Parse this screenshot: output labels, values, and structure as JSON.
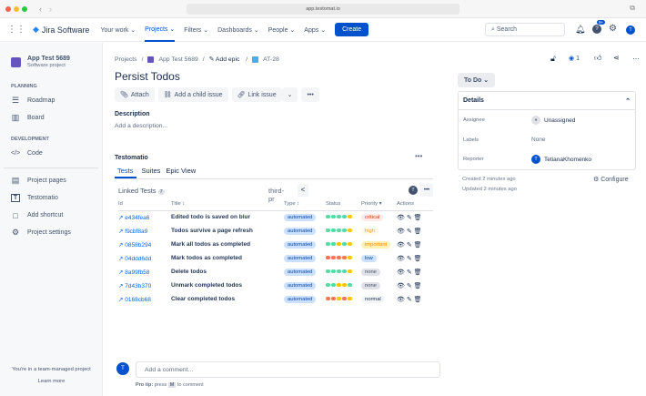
{
  "browser": {
    "url": "app.testomat.io"
  },
  "topnav": {
    "product": "Jira Software",
    "items": [
      "Your work",
      "Projects",
      "Filters",
      "Dashboards",
      "People",
      "Apps"
    ],
    "create": "Create",
    "search_placeholder": "Search",
    "notif_badge": "9+",
    "avatar": "T"
  },
  "sidebar": {
    "project_name": "App Test 5689",
    "project_type": "Software project",
    "planning": "PLANNING",
    "roadmap": "Roadmap",
    "board": "Board",
    "development": "DEVELOPMENT",
    "code": "Code",
    "project_pages": "Project pages",
    "testomatio": "Testomatio",
    "add_shortcut": "Add shortcut",
    "project_settings": "Project settings",
    "team_note": "You're in a team-managed project",
    "learn_more": "Learn more"
  },
  "breadcrumb": {
    "projects": "Projects",
    "project": "App Test 5689",
    "epic": "Add epic",
    "issue": "AT-28"
  },
  "issue": {
    "title": "Persist Todos",
    "attach": "Attach",
    "add_child": "Add a child issue",
    "link_issue": "Link issue",
    "description_label": "Description",
    "description_placeholder": "Add a description...",
    "watch_count": "1"
  },
  "testomatio": {
    "title": "Testomatio",
    "tabs": [
      "Tests",
      "Suites",
      "Epic View"
    ],
    "linked_tests": "Linked Tests",
    "count": "7",
    "branch": "third-pr",
    "avatar": "T",
    "columns": [
      "Id",
      "Title",
      "Type",
      "Status",
      "Priority",
      "Actions"
    ],
    "rows": [
      {
        "id": "e434fea6",
        "title": "Edited todo is saved on blur",
        "type": "automated",
        "status": [
          "g",
          "g",
          "g",
          "g",
          "y"
        ],
        "priority": "critical"
      },
      {
        "id": "f9cbf8a9",
        "title": "Todos survive a page refresh",
        "type": "automated",
        "status": [
          "g",
          "g",
          "g",
          "g",
          "y"
        ],
        "priority": "high"
      },
      {
        "id": "0858b294",
        "title": "Mark all todos as completed",
        "type": "automated",
        "status": [
          "g",
          "g",
          "y",
          "g",
          "y"
        ],
        "priority": "important"
      },
      {
        "id": "04ddd6dd",
        "title": "Mark todos as completed",
        "type": "automated",
        "status": [
          "r",
          "r",
          "r",
          "r",
          "y"
        ],
        "priority": "low"
      },
      {
        "id": "8a99fb58",
        "title": "Delete todos",
        "type": "automated",
        "status": [
          "g",
          "g",
          "g",
          "g",
          "y"
        ],
        "priority": "none"
      },
      {
        "id": "7d43b370",
        "title": "Unmark completed todos",
        "type": "automated",
        "status": [
          "g",
          "g",
          "y",
          "y",
          "g"
        ],
        "priority": "none"
      },
      {
        "id": "0168cb68",
        "title": "Clear completed todos",
        "type": "automated",
        "status": [
          "r",
          "r",
          "y",
          "r",
          "y"
        ],
        "priority": "normal"
      }
    ]
  },
  "colors": {
    "g": "#57d9a3",
    "y": "#ffc400",
    "r": "#ff7452",
    "critical": [
      "#ffebe6",
      "#de350b"
    ],
    "high": [
      "#fffae6",
      "#ff991f"
    ],
    "important": [
      "#fff0b3",
      "#ff8b00"
    ],
    "low": [
      "#cce0ff",
      "#0747a6"
    ],
    "none": [
      "#dfe1e6",
      "#42526e"
    ],
    "normal": [
      "#f4f5f7",
      "#172b4d"
    ]
  },
  "details": {
    "status": "To Do",
    "title": "Details",
    "assignee_label": "Assignee",
    "assignee": "Unassigned",
    "labels_label": "Labels",
    "labels": "None",
    "reporter_label": "Reporter",
    "reporter": "TetianaKhomenko",
    "reporter_avatar": "T",
    "created": "Created 2 minutes ago",
    "updated": "Updated 2 minutes ago",
    "configure": "Configure"
  },
  "comment": {
    "avatar": "T",
    "placeholder": "Add a comment...",
    "tip_bold": "Pro tip:",
    "tip_pre": "press",
    "tip_key": "M",
    "tip_post": "to comment"
  }
}
